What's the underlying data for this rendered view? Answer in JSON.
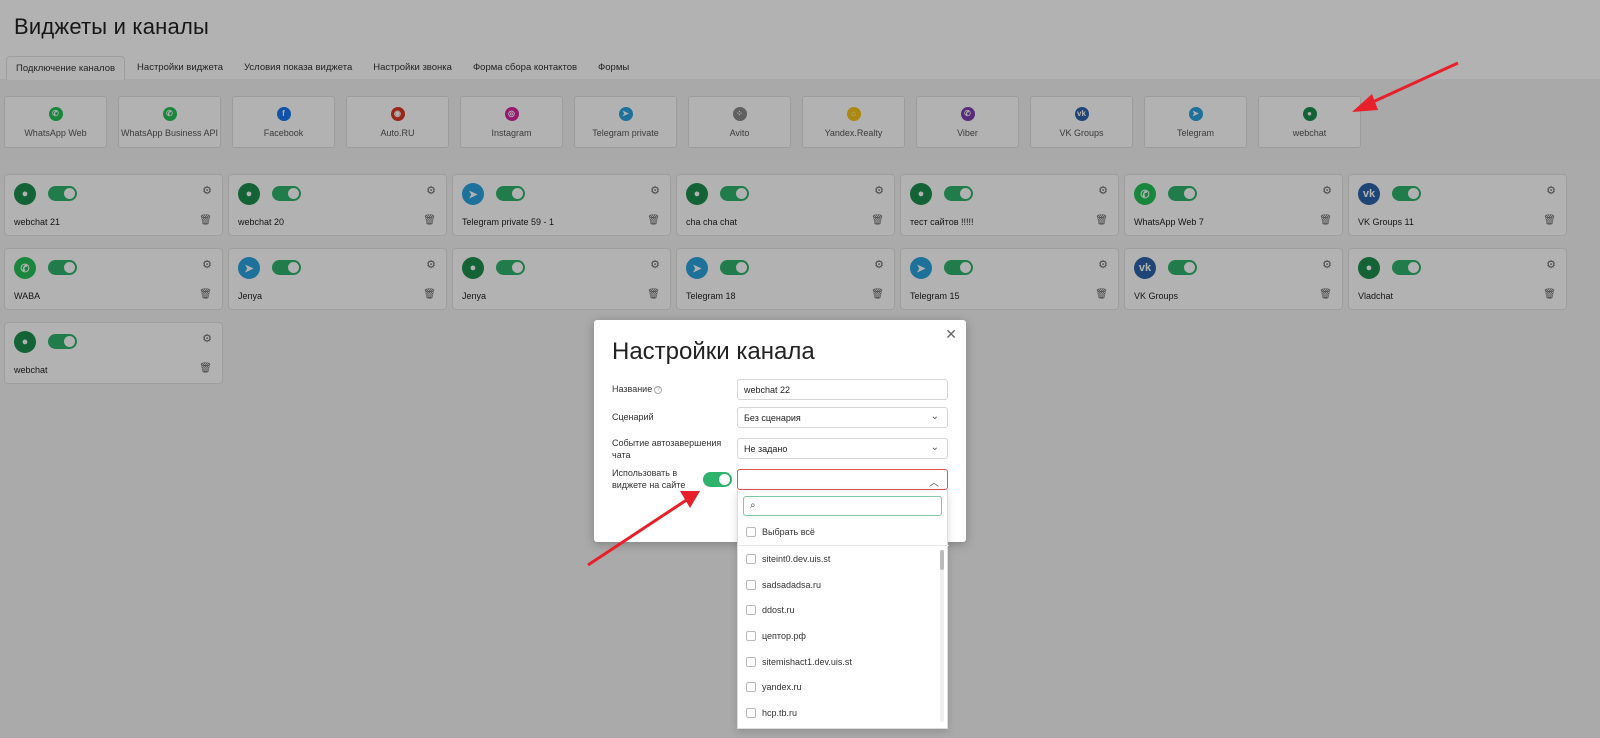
{
  "page": {
    "title": "Виджеты и каналы"
  },
  "tabs": [
    {
      "label": "Подключение каналов",
      "active": true
    },
    {
      "label": "Настройки виджета"
    },
    {
      "label": "Условия показа виджета"
    },
    {
      "label": "Настройки звонка"
    },
    {
      "label": "Форма сбора контактов"
    },
    {
      "label": "Формы"
    }
  ],
  "providers": [
    {
      "label": "WhatsApp Web",
      "icon": "whatsapp-icon",
      "color": "#25c15a"
    },
    {
      "label": "WhatsApp Business API",
      "icon": "whatsapp-icon",
      "color": "#25c15a"
    },
    {
      "label": "Facebook",
      "icon": "facebook-icon",
      "color": "#1877f2"
    },
    {
      "label": "Auto.RU",
      "icon": "autoru-icon",
      "color": "#db3727"
    },
    {
      "label": "Instagram",
      "icon": "instagram-icon",
      "color": "#d6249f"
    },
    {
      "label": "Telegram private",
      "icon": "telegram-icon",
      "color": "#2aa3df"
    },
    {
      "label": "Avito",
      "icon": "avito-icon",
      "color": "#8a8a8a"
    },
    {
      "label": "Yandex.Realty",
      "icon": "yandex-realty-icon",
      "color": "#f5c518"
    },
    {
      "label": "Viber",
      "icon": "viber-icon",
      "color": "#7d3daf"
    },
    {
      "label": "VK Groups",
      "icon": "vk-icon",
      "color": "#2c64a8"
    },
    {
      "label": "Telegram",
      "icon": "telegram-icon",
      "color": "#2aa3df"
    },
    {
      "label": "webchat",
      "icon": "webchat-icon",
      "color": "#1e8f4e"
    }
  ],
  "channels": [
    {
      "name": "webchat 21",
      "icon": "webchat-icon",
      "color": "#1e8f4e"
    },
    {
      "name": "webchat 20",
      "icon": "webchat-icon",
      "color": "#1e8f4e"
    },
    {
      "name": "Telegram private 59 - 1",
      "icon": "telegram-icon",
      "color": "#2aa3df"
    },
    {
      "name": "cha cha chat",
      "icon": "webchat-icon",
      "color": "#1e8f4e"
    },
    {
      "name": "тест сайтов !!!!!",
      "icon": "webchat-icon",
      "color": "#1e8f4e"
    },
    {
      "name": "WhatsApp Web 7",
      "icon": "whatsapp-icon",
      "color": "#25c15a"
    },
    {
      "name": "VK Groups 11",
      "icon": "vk-icon",
      "color": "#2c64a8"
    },
    {
      "name": "WABA",
      "icon": "whatsapp-icon",
      "color": "#25c15a"
    },
    {
      "name": "Jenya",
      "icon": "telegram-icon",
      "color": "#2aa3df"
    },
    {
      "name": "Jenya",
      "icon": "webchat-icon",
      "color": "#1e8f4e"
    },
    {
      "name": "Telegram 18",
      "icon": "telegram-icon",
      "color": "#2aa3df"
    },
    {
      "name": "Telegram 15",
      "icon": "telegram-icon",
      "color": "#2aa3df"
    },
    {
      "name": "VK Groups",
      "icon": "vk-icon",
      "color": "#2c64a8"
    },
    {
      "name": "Vladchat",
      "icon": "webchat-icon",
      "color": "#1e8f4e"
    },
    {
      "name": "webchat",
      "icon": "webchat-icon",
      "color": "#1e8f4e"
    }
  ],
  "modal": {
    "title": "Настройки канала",
    "name_label": "Название",
    "name_value": "webchat 22",
    "scenario_label": "Сценарий",
    "scenario_value": "Без сценария",
    "autoclose_label_1": "Событие автозавершения",
    "autoclose_label_2": "чата",
    "autoclose_value": "Не задано",
    "use_label_1": "Использовать в",
    "use_label_2": "виджете на сайте",
    "use_toggle": true,
    "sites_value": ""
  },
  "dropdown": {
    "search_placeholder": "",
    "select_all": "Выбрать всё",
    "options": [
      "siteint0.dev.uis.st",
      "sadsadadsa.ru",
      "ddost.ru",
      "цептор.рф",
      "sitemishact1.dev.uis.st",
      "yandex.ru",
      "hcp.tb.ru"
    ]
  },
  "colors": {
    "accent": "#2eb36c",
    "error_border": "#e05555",
    "annotation_arrow": "#e8202a"
  }
}
